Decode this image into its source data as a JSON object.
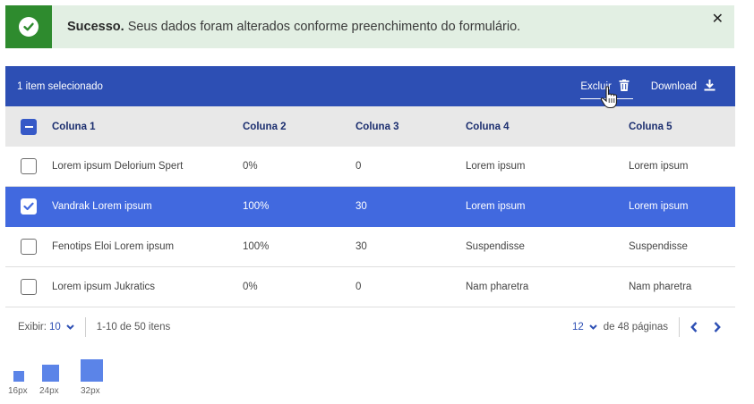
{
  "alert": {
    "title": "Sucesso.",
    "message": " Seus dados foram alterados conforme preenchimento do formulário.",
    "close_icon": "close-icon",
    "status_icon": "check-circle-icon",
    "color": "#2e8b2e",
    "background": "#e2efe3"
  },
  "bulkbar": {
    "selected_text": "1 item selecionado",
    "delete_label": "Excluir",
    "delete_icon": "trash-icon",
    "download_label": "Download",
    "download_icon": "download-icon",
    "color": "#2d4fb4"
  },
  "table": {
    "columns": [
      "Coluna 1",
      "Coluna 2",
      "Coluna 3",
      "Coluna 4",
      "Coluna 5"
    ],
    "rows": [
      {
        "checked": false,
        "cells": [
          "Lorem ipsum Delorium Spert",
          "0%",
          "0",
          "Lorem ipsum",
          "Lorem ipsum"
        ]
      },
      {
        "checked": true,
        "cells": [
          "Vandrak Lorem ipsum",
          "100%",
          "30",
          "Lorem ipsum",
          "Lorem ipsum"
        ]
      },
      {
        "checked": false,
        "cells": [
          "Fenotips Eloi Lorem ipsum",
          "100%",
          "30",
          "Suspendisse",
          "Suspendisse"
        ]
      },
      {
        "checked": false,
        "cells": [
          "Lorem ipsum Jukratics",
          "0%",
          "0",
          "Nam pharetra",
          "Nam pharetra"
        ]
      }
    ],
    "selected_row_color": "#4169df"
  },
  "pagination": {
    "show_label": "Exibir:",
    "show_value": "10",
    "range_text": "1-10 de 50 itens",
    "current_page": "12",
    "total_pages_text": "de 48 páginas",
    "prev_icon": "chevron-left-icon",
    "next_icon": "chevron-right-icon"
  },
  "sizes": {
    "labels": [
      "16px",
      "24px",
      "32px"
    ],
    "color": "#5b84e8"
  }
}
